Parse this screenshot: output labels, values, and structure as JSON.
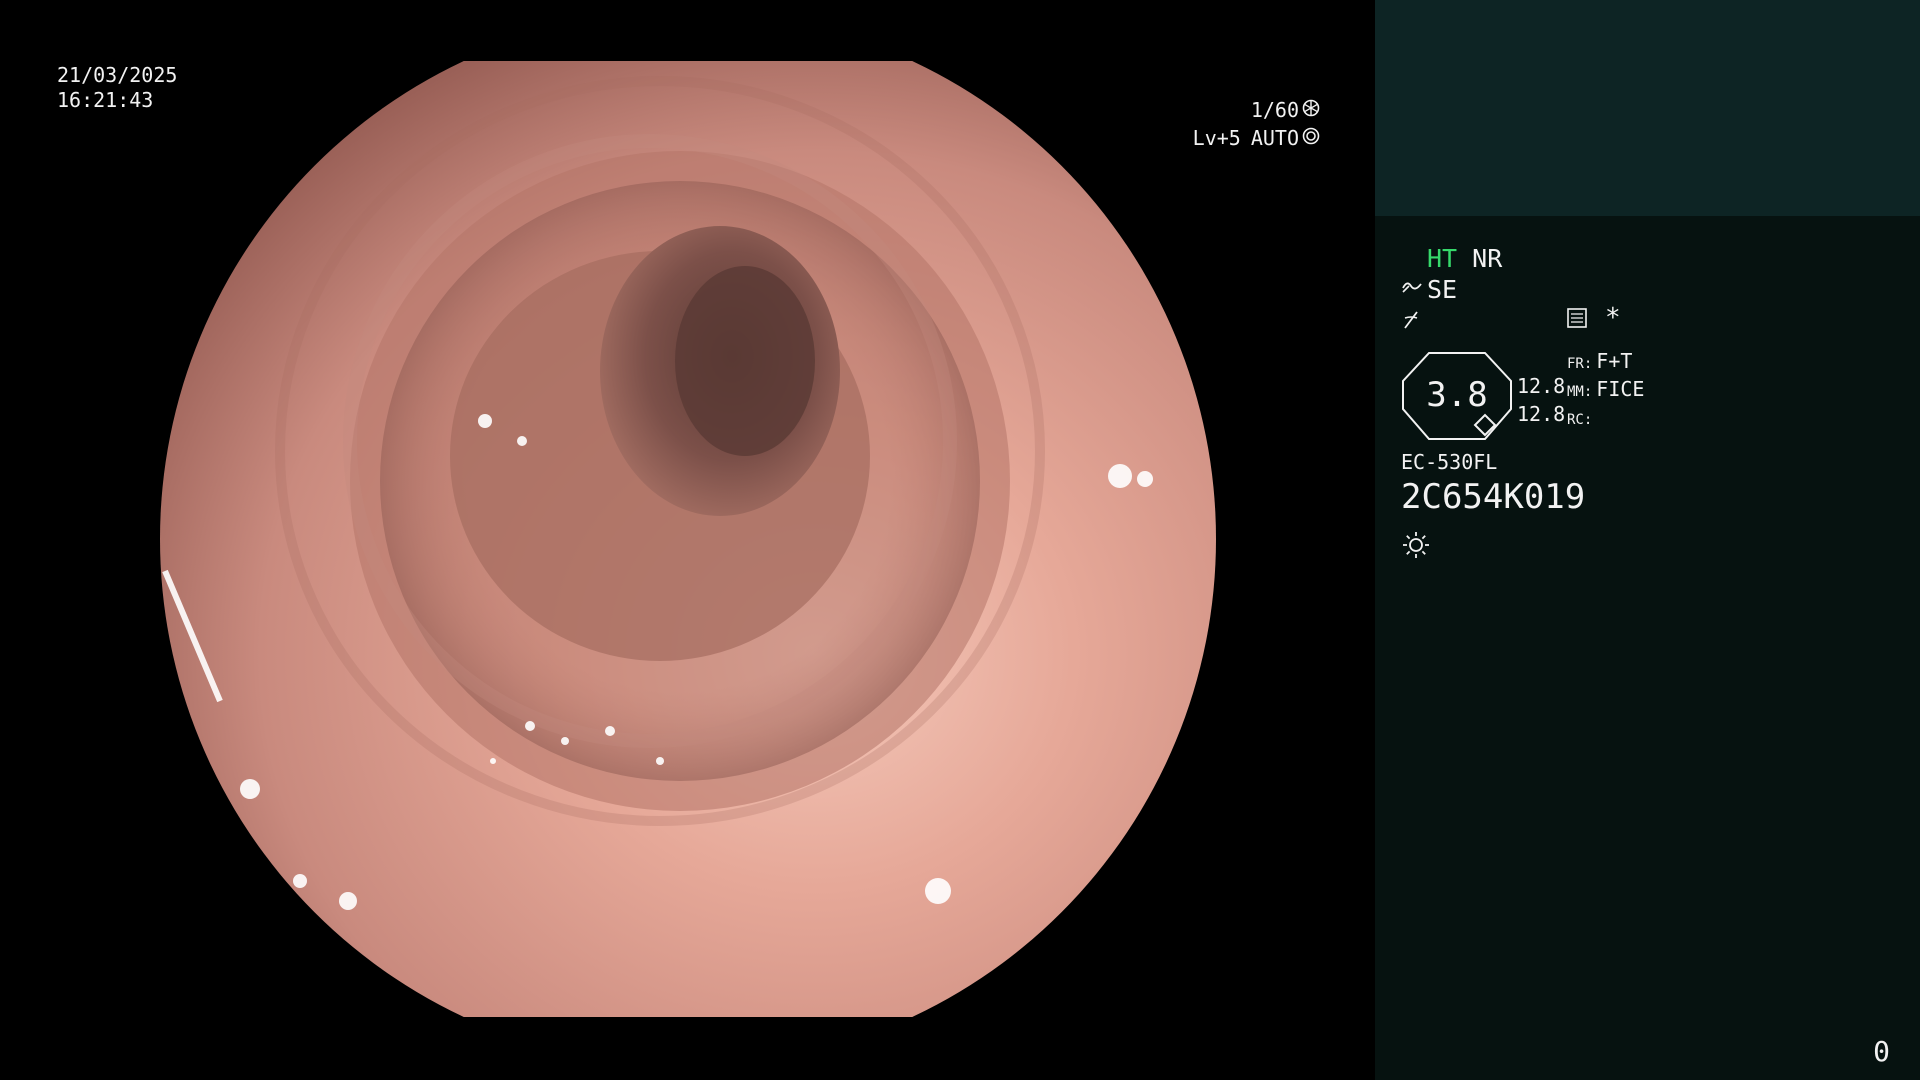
{
  "overlay": {
    "date": "21/03/2025",
    "time": "16:21:43",
    "shutter": "1/60",
    "shutter_icon": "aperture-icon",
    "level": "Lv+5",
    "exposure_mode": "AUTO",
    "exposure_icon": "auto-iris-icon"
  },
  "panel": {
    "mode_ht": "HT",
    "mode_nr": "NR",
    "mode_se": "SE",
    "star": "*",
    "zoom": "3.8",
    "num_a": "12.8",
    "num_b": "12.8",
    "fr_label": "FR:",
    "fr_value": "F+T",
    "mm_label": "MM:",
    "mm_value": "FICE",
    "rc_label": "RC:",
    "rc_value": "",
    "scope_model": "EC-530FL",
    "serial": "2C654K019",
    "light_icon": "light-icon",
    "counter": "0"
  },
  "colors": {
    "panel_top": "#0d2424",
    "panel_bg": "#061210",
    "accent_green": "#36d96b"
  }
}
